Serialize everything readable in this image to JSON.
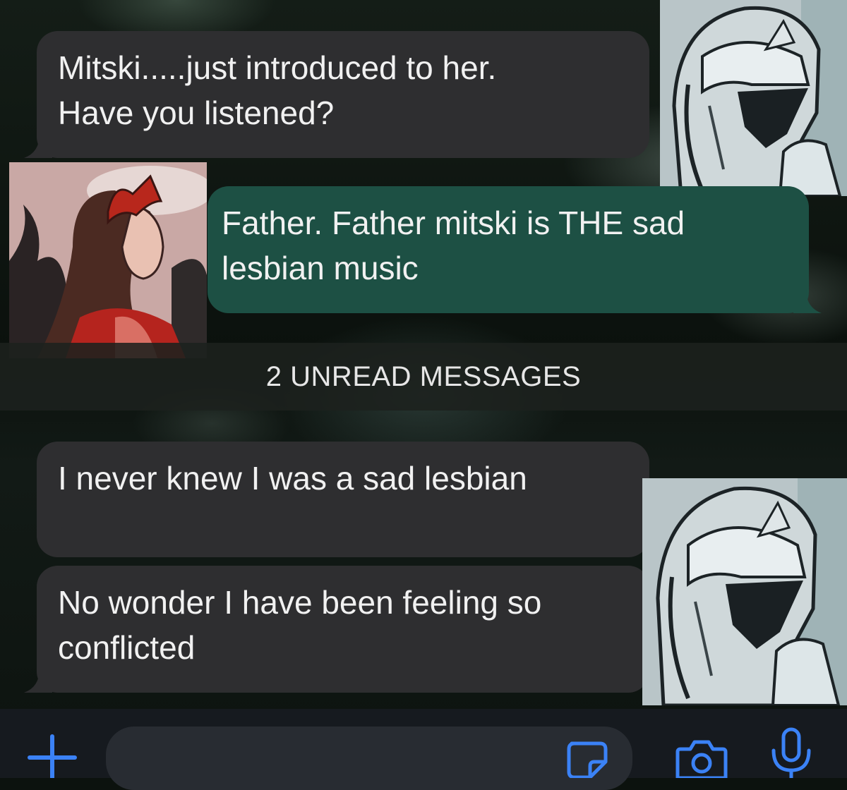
{
  "messages": [
    {
      "id": 1,
      "direction": "incoming",
      "lines": [
        "Mitski.....just introduced to her.",
        "Have you listened?"
      ]
    },
    {
      "id": 2,
      "direction": "outgoing",
      "lines": [
        "Father. Father mitski is THE sad",
        "lesbian music"
      ]
    },
    {
      "id": 3,
      "direction": "incoming",
      "lines": [
        "I never knew I was a sad lesbian"
      ]
    },
    {
      "id": 4,
      "direction": "incoming",
      "lines": [
        "No wonder I have been feeling so",
        "conflicted"
      ]
    }
  ],
  "unread_divider": {
    "label": "2 UNREAD MESSAGES"
  },
  "composer": {
    "input_value": "",
    "placeholder": ""
  },
  "icons": {
    "add": "plus-icon",
    "sticker": "sticker-icon",
    "camera": "camera-icon",
    "mic": "microphone-icon"
  },
  "colors": {
    "incoming_bubble": "#2e2e30",
    "outgoing_bubble": "#1d5044",
    "accent": "#3b82f6",
    "divider_bar": "#1c211e"
  }
}
